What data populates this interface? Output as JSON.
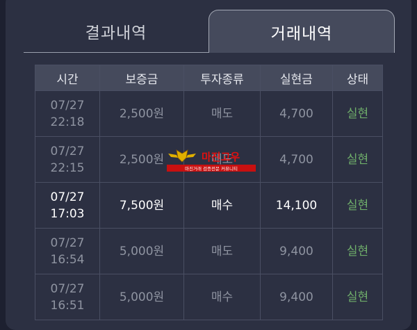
{
  "tabs": {
    "left_label": "결과내역",
    "right_label": "거래내역"
  },
  "table": {
    "headers": [
      "시간",
      "보증금",
      "투자종류",
      "실현금",
      "상태"
    ],
    "rows": [
      {
        "date": "07/27",
        "time": "22:18",
        "deposit": "2,500원",
        "type": "매도",
        "realized": "4,700",
        "status": "실현"
      },
      {
        "date": "07/27",
        "time": "22:15",
        "deposit": "2,500원",
        "type": "매도",
        "realized": "4,700",
        "status": "실현"
      },
      {
        "date": "07/27",
        "time": "17:03",
        "deposit": "7,500원",
        "type": "매수",
        "realized": "14,100",
        "status": "실현"
      },
      {
        "date": "07/27",
        "time": "16:54",
        "deposit": "5,000원",
        "type": "매도",
        "realized": "9,400",
        "status": "실현"
      },
      {
        "date": "07/27",
        "time": "16:51",
        "deposit": "5,000원",
        "type": "매수",
        "realized": "9,400",
        "status": "실현"
      }
    ]
  },
  "watermark": {
    "logo_text": "마진고우",
    "tagline": "마진거래 검증전문 커뮤니티"
  },
  "colors": {
    "background": "#1d2030",
    "panel": "#2c3042",
    "header_row": "#454a5c",
    "status_green": "#6fae6a"
  }
}
